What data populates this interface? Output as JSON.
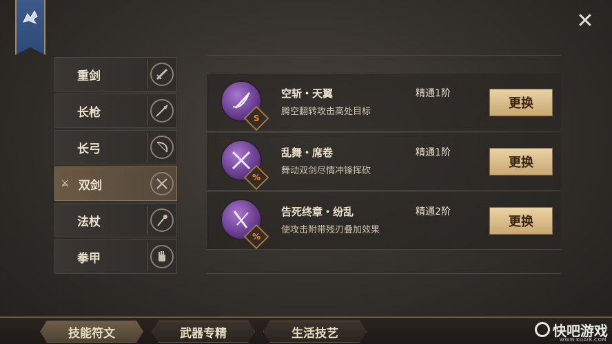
{
  "weapons": [
    {
      "label": "重剑",
      "icon": "heavy-sword-icon",
      "active": false
    },
    {
      "label": "长枪",
      "icon": "spear-icon",
      "active": false
    },
    {
      "label": "长弓",
      "icon": "bow-icon",
      "active": false
    },
    {
      "label": "双剑",
      "icon": "dual-swords-icon",
      "active": true
    },
    {
      "label": "法杖",
      "icon": "staff-icon",
      "active": false
    },
    {
      "label": "拳甲",
      "icon": "gauntlet-icon",
      "active": false
    }
  ],
  "skills": [
    {
      "name": "空斩・天翼",
      "desc": "腾空翻转攻击高处目标",
      "level": "精通1阶",
      "button": "更换",
      "icon": "sword-slash-icon"
    },
    {
      "name": "乱舞・席卷",
      "desc": "舞动双剑尽情冲锋挥砍",
      "level": "精通1阶",
      "button": "更换",
      "icon": "crossed-swords-icon"
    },
    {
      "name": "告死终章・纷乱",
      "desc": "使攻击附带残刃叠加效果",
      "level": "精通2阶",
      "button": "更换",
      "icon": "blade-strike-icon"
    }
  ],
  "tabs": [
    {
      "label": "技能符文",
      "active": true
    },
    {
      "label": "武器专精",
      "active": false
    },
    {
      "label": "生活技艺",
      "active": false
    }
  ],
  "watermark": {
    "text": "快吧游戏",
    "sub": "WWW.KUAI8.COM"
  },
  "colors": {
    "accent_gold": "#c9a873",
    "skill_purple": "#6b3f93",
    "banner_blue": "#2e4a78"
  }
}
